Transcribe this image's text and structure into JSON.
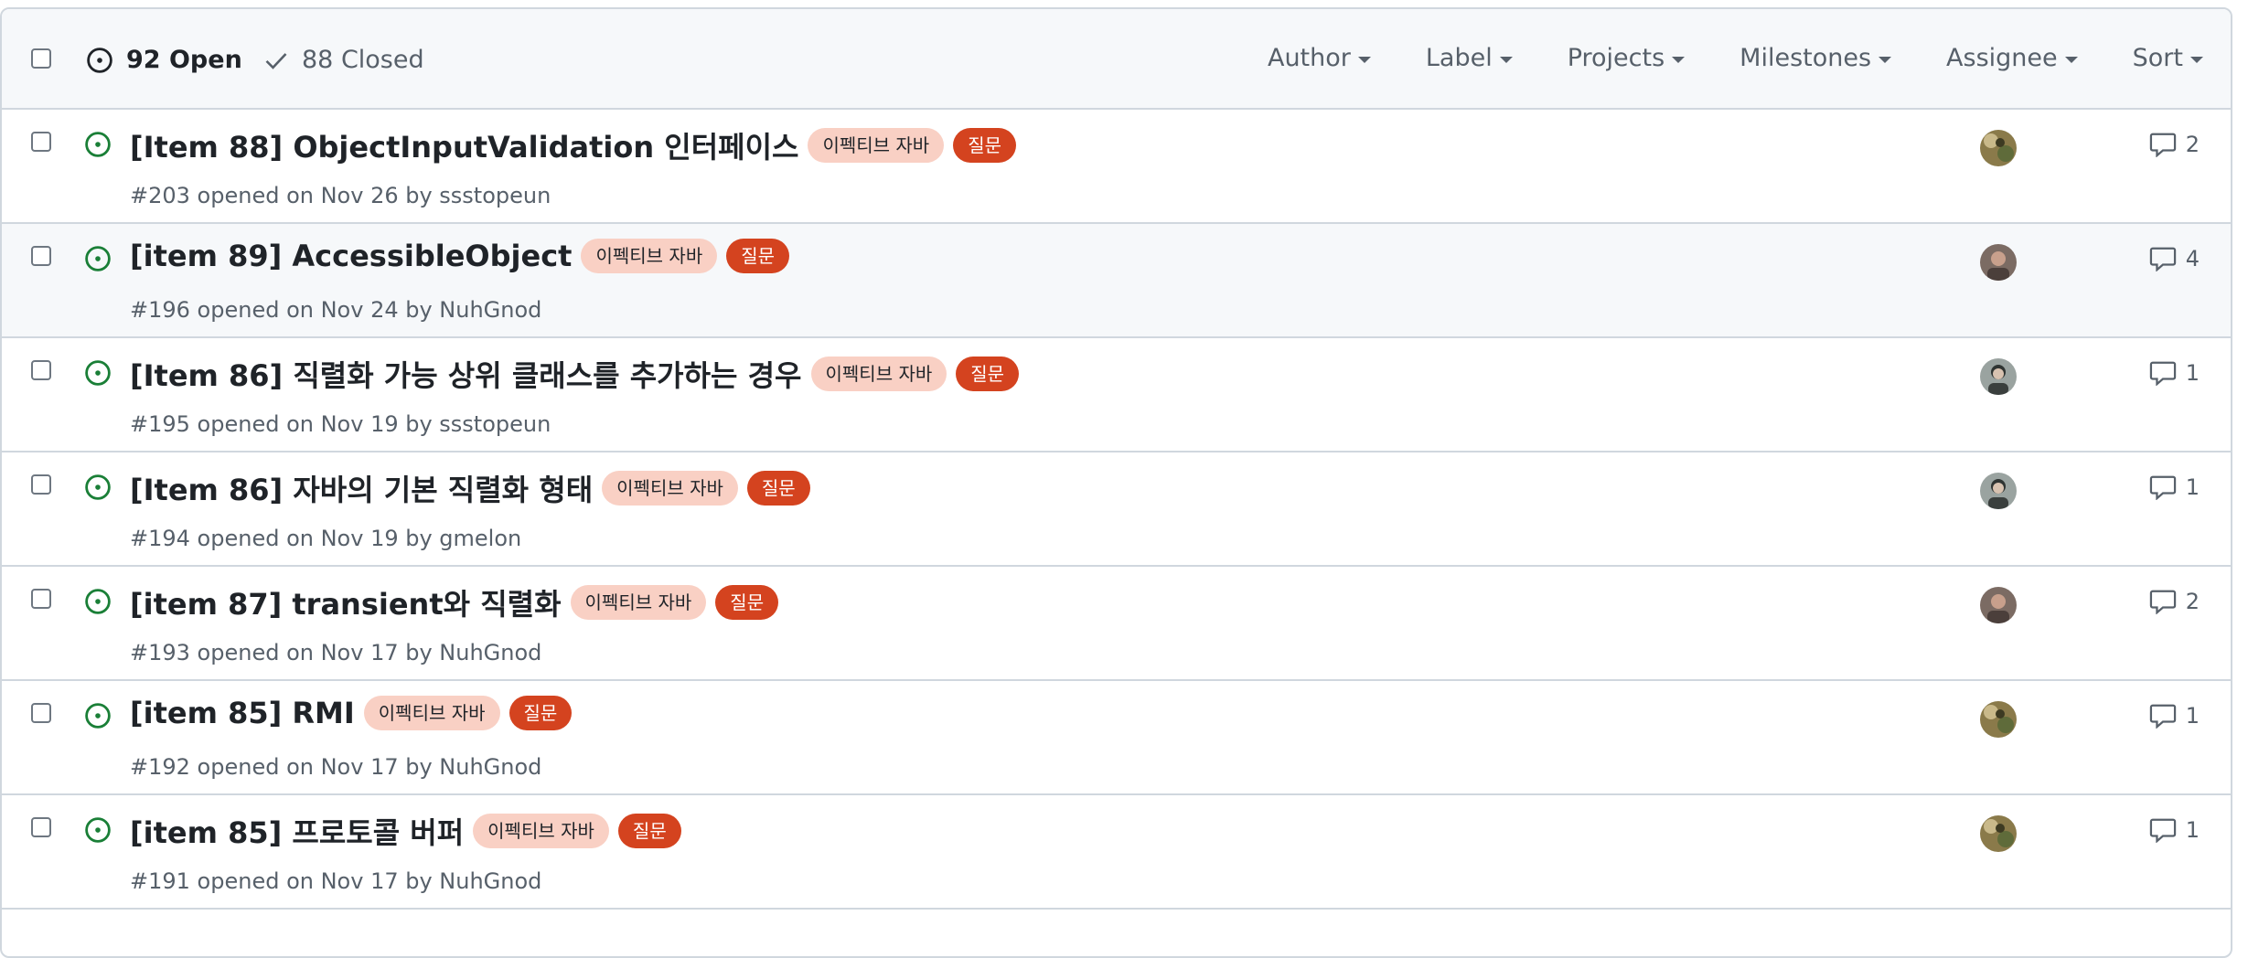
{
  "header": {
    "open_label": "92 Open",
    "closed_label": "88 Closed",
    "filters": [
      "Author",
      "Label",
      "Projects",
      "Milestones",
      "Assignee",
      "Sort"
    ]
  },
  "colors": {
    "open_icon": "#1a7f37",
    "label_effective_java_bg": "#f9d0c4",
    "label_question_bg": "#d4431f"
  },
  "issues": [
    {
      "title": "[Item 88] ObjectInputValidation 인터페이스",
      "label1": "이펙티브 자바",
      "label2": "질문",
      "meta": "#203 opened on Nov 26 by ssstopeun",
      "comments": "2",
      "avatar": "avatar-icon-a"
    },
    {
      "title": "[item 89] AccessibleObject",
      "label1": "이펙티브 자바",
      "label2": "질문",
      "meta": "#196 opened on Nov 24 by NuhGnod",
      "comments": "4",
      "avatar": "avatar-icon-b"
    },
    {
      "title": "[Item 86] 직렬화 가능 상위 클래스를 추가하는 경우",
      "label1": "이펙티브 자바",
      "label2": "질문",
      "meta": "#195 opened on Nov 19 by ssstopeun",
      "comments": "1",
      "avatar": "avatar-icon-c"
    },
    {
      "title": "[Item 86] 자바의 기본 직렬화 형태",
      "label1": "이펙티브 자바",
      "label2": "질문",
      "meta": "#194 opened on Nov 19 by gmelon",
      "comments": "1",
      "avatar": "avatar-icon-c"
    },
    {
      "title": "[item 87] transient와 직렬화",
      "label1": "이펙티브 자바",
      "label2": "질문",
      "meta": "#193 opened on Nov 17 by NuhGnod",
      "comments": "2",
      "avatar": "avatar-icon-b"
    },
    {
      "title": "[item 85] RMI",
      "label1": "이펙티브 자바",
      "label2": "질문",
      "meta": "#192 opened on Nov 17 by NuhGnod",
      "comments": "1",
      "avatar": "avatar-icon-a"
    },
    {
      "title": "[item 85] 프로토콜 버퍼",
      "label1": "이펙티브 자바",
      "label2": "질문",
      "meta": "#191 opened on Nov 17 by NuhGnod",
      "comments": "1",
      "avatar": "avatar-icon-a"
    }
  ]
}
